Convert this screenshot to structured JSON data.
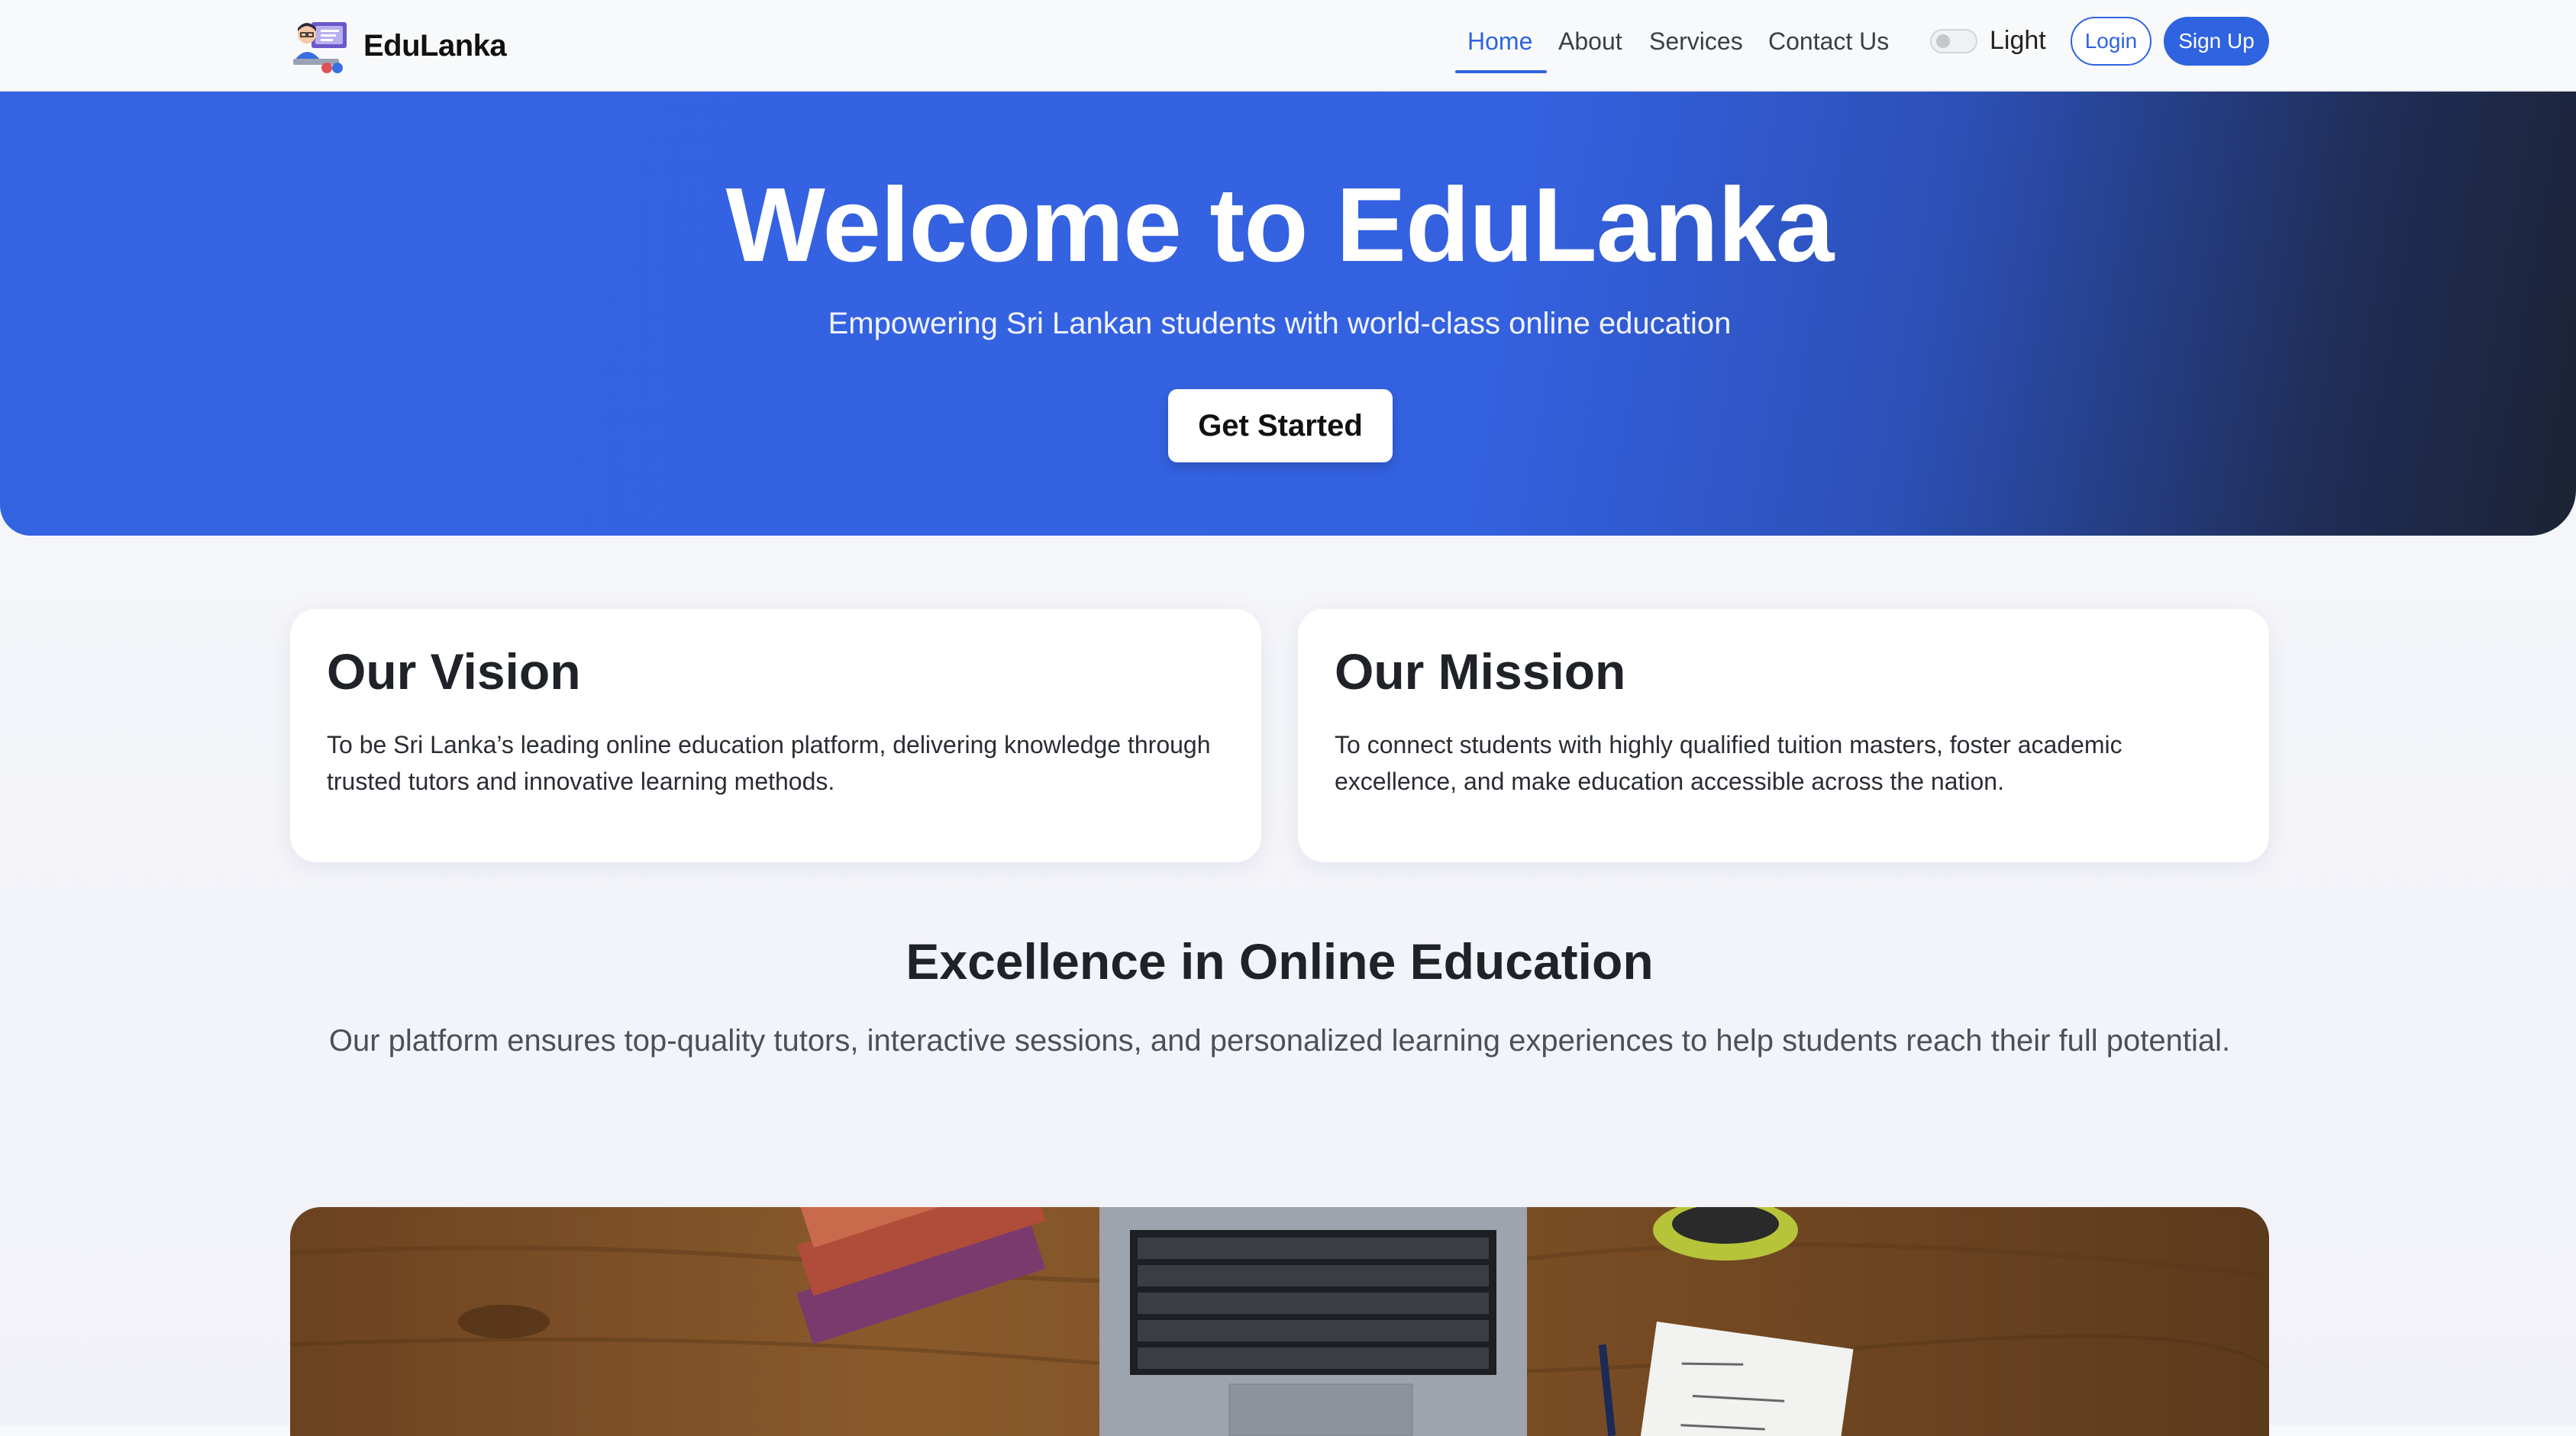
{
  "nav": {
    "brand": "EduLanka",
    "links": [
      {
        "label": "Home",
        "active": true
      },
      {
        "label": "About",
        "active": false
      },
      {
        "label": "Services",
        "active": false
      },
      {
        "label": "Contact Us",
        "active": false
      }
    ],
    "theme_toggle_label": "Light",
    "login_label": "Login",
    "signup_label": "Sign Up"
  },
  "hero": {
    "title": "Welcome to EduLanka",
    "subtitle": "Empowering Sri Lankan students with world-class online education",
    "cta_label": "Get Started"
  },
  "cards": {
    "vision": {
      "title": "Our Vision",
      "text": "To be Sri Lanka’s leading online education platform, delivering knowledge through trusted tutors and innovative learning methods."
    },
    "mission": {
      "title": "Our Mission",
      "text": "To connect students with highly qualified tuition masters, foster academic excellence, and make education accessible across the nation."
    }
  },
  "excellence": {
    "title": "Excellence in Online Education",
    "text": "Our platform ensures top-quality tutors, interactive sessions, and personalized learning experiences to help students reach their full potential."
  },
  "colors": {
    "primary": "#2f63e0",
    "hero_start": "#3564e3",
    "hero_end": "#1c2334",
    "heading": "#1f2227"
  },
  "icons": [
    "edulanka-logo-icon",
    "theme-toggle-switch"
  ]
}
